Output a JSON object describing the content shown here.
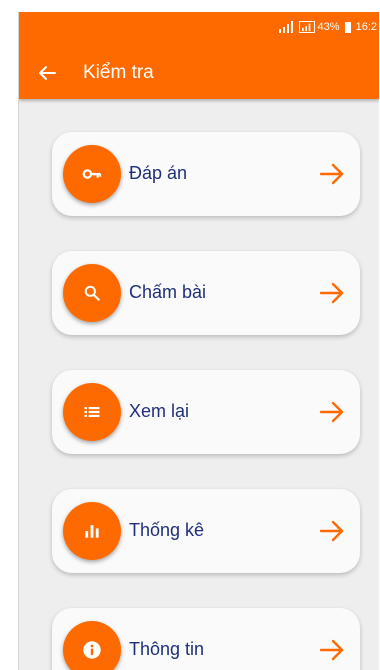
{
  "status_bar": {
    "battery": "43%",
    "time": "16:2",
    "icons": [
      "signal-icon",
      "signal-icon",
      "battery-icon"
    ]
  },
  "app_bar": {
    "title": "Kiểm tra",
    "back_icon": "arrow-left-icon",
    "background": "#ff6a00"
  },
  "menu": {
    "accent": "#ff6a00",
    "label_color": "#1f2f7a",
    "items": [
      {
        "label": "Đáp án",
        "icon": "key-icon"
      },
      {
        "label": "Chấm bài",
        "icon": "search-icon"
      },
      {
        "label": "Xem lại",
        "icon": "list-icon"
      },
      {
        "label": "Thống kê",
        "icon": "bar-chart-icon"
      },
      {
        "label": "Thông tin",
        "icon": "info-icon"
      }
    ]
  }
}
